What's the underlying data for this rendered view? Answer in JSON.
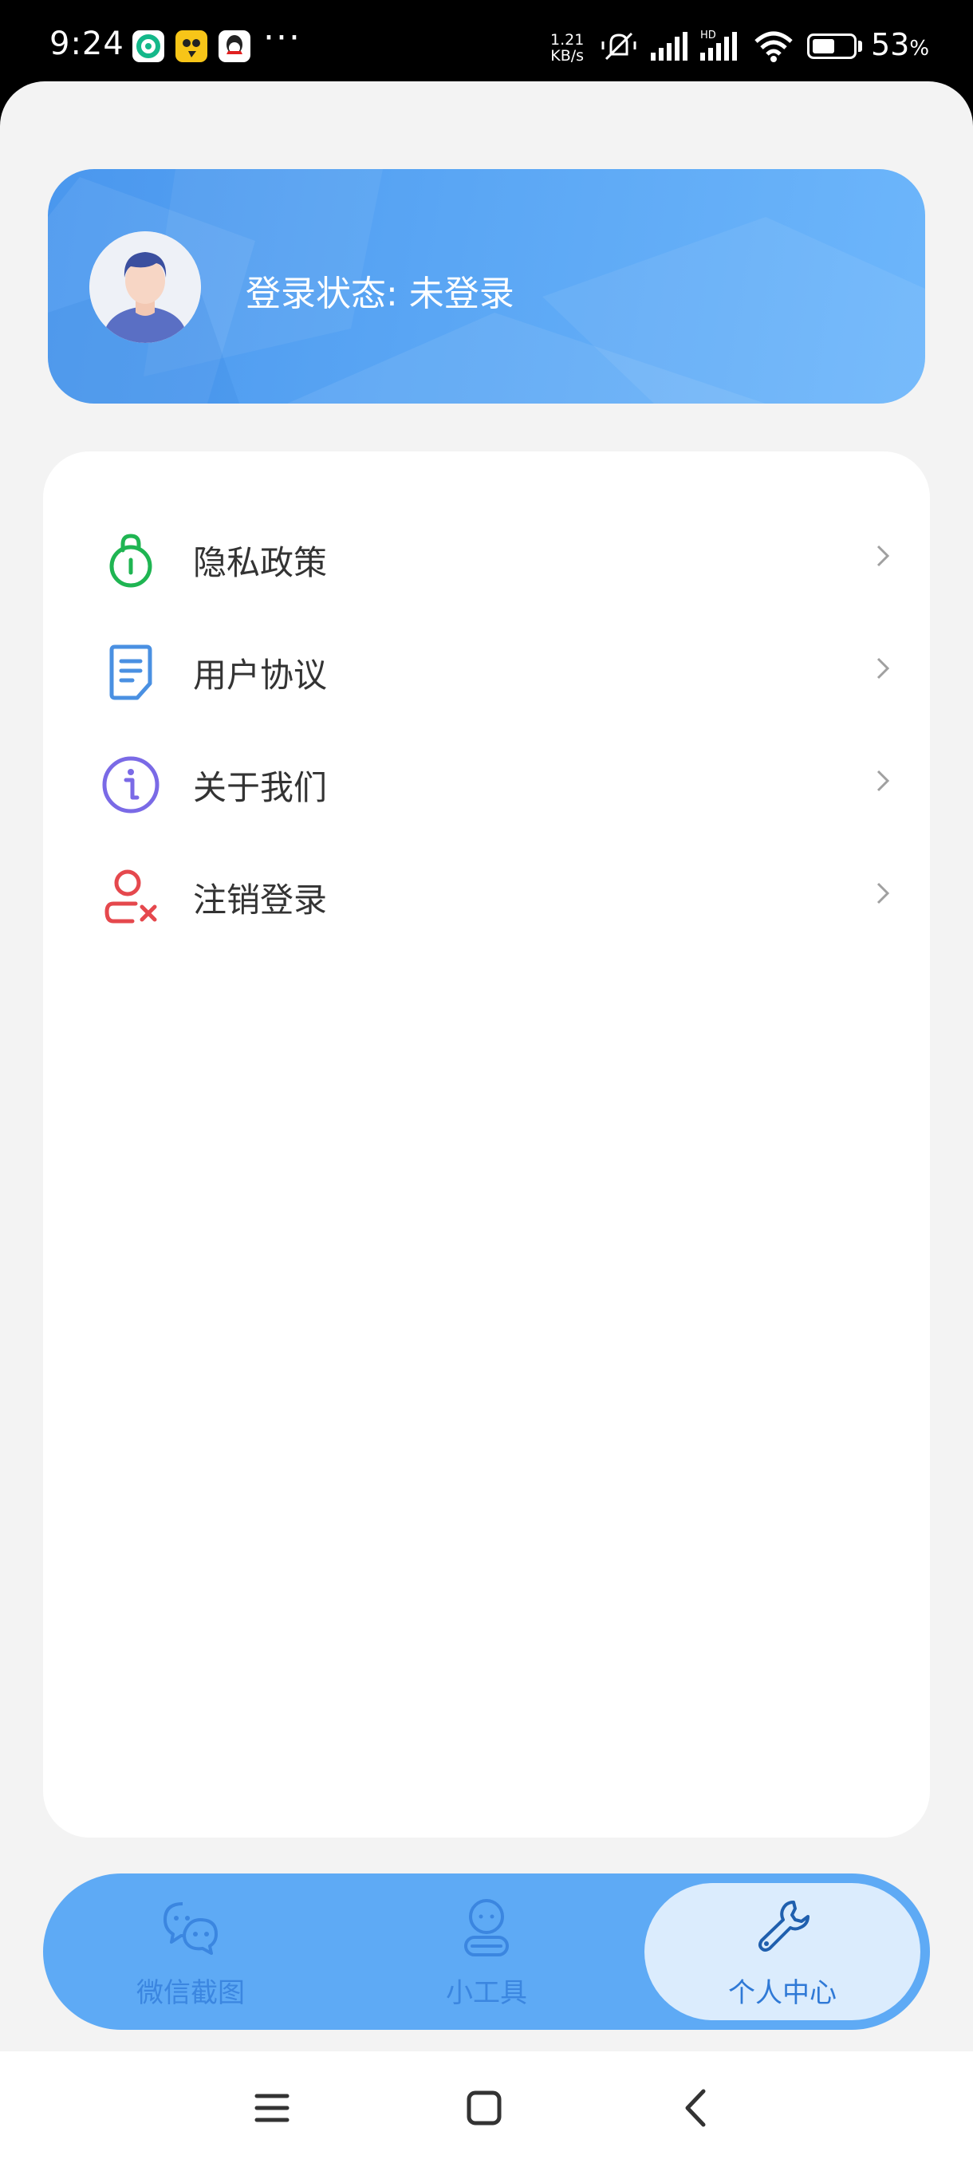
{
  "status_bar": {
    "time": "9:24",
    "apps": [
      "green-sync-app-icon",
      "yellow-app-icon",
      "qq-icon"
    ],
    "more": "···",
    "speed_value": "1.21",
    "speed_unit": "KB/s",
    "battery_percent": "53",
    "battery_suffix": "%",
    "battery_level": 0.53,
    "hd_label": "HD"
  },
  "profile": {
    "login_status": "登录状态: 未登录"
  },
  "menu": {
    "items": [
      {
        "label": "隐私政策",
        "icon": "lock-icon",
        "color": "#1fb552"
      },
      {
        "label": "用户协议",
        "icon": "document-icon",
        "color": "#4a90e2"
      },
      {
        "label": "关于我们",
        "icon": "info-icon",
        "color": "#7a6ae6"
      },
      {
        "label": "注销登录",
        "icon": "user-remove-icon",
        "color": "#e5484d"
      }
    ]
  },
  "tabbar": {
    "tabs": [
      {
        "label": "微信截图",
        "icon": "chat-bubbles-icon",
        "active": false
      },
      {
        "label": "小工具",
        "icon": "robot-icon",
        "active": false
      },
      {
        "label": "个人中心",
        "icon": "wrench-icon",
        "active": true
      }
    ]
  },
  "colors": {
    "accent": "#5eaaf5",
    "tab_text": "#3b86e0",
    "active_tab_bg": "#dbecfd"
  }
}
